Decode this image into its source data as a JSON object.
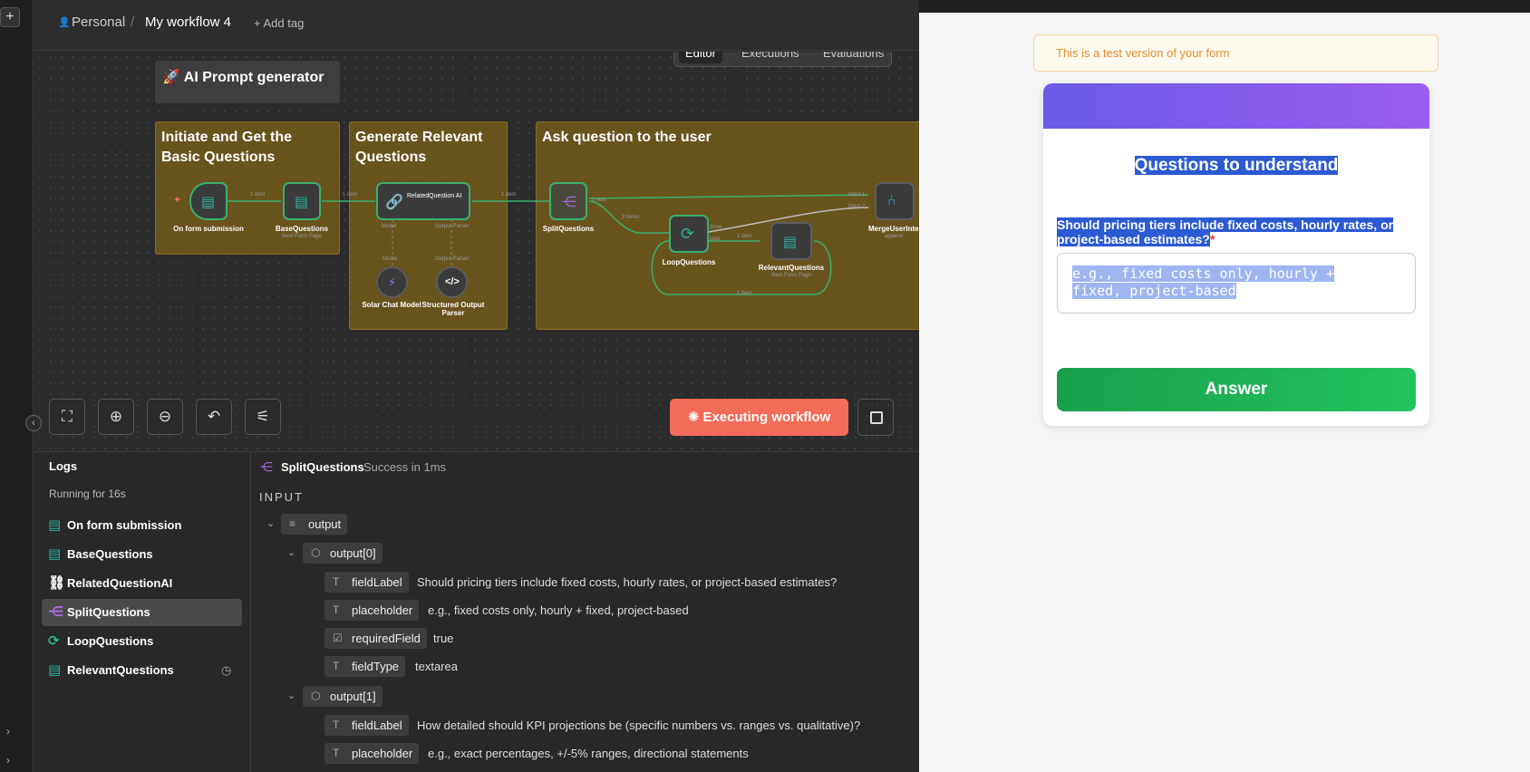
{
  "topbar": {
    "project": "Personal",
    "sep": "/",
    "workflow_name": "My workflow 4",
    "add_tag": "+ Add tag"
  },
  "tabs": [
    "Editor",
    "Executions",
    "Evaluations"
  ],
  "canvas": {
    "title_card": "🚀 AI Prompt generator",
    "groups": [
      "Initiate and Get the Basic Questions",
      "Generate Relevant Questions",
      "Ask question to the user"
    ],
    "nodes": {
      "form_submission": {
        "label": "On form submission"
      },
      "base_questions": {
        "label": "BaseQuestions",
        "sub": "Next Form Page"
      },
      "related_ai": {
        "label": "RelatedQuestion AI"
      },
      "split": {
        "label": "SplitQuestions"
      },
      "loop": {
        "label": "LoopQuestions"
      },
      "relevant": {
        "label": "RelevantQuestions",
        "sub": "Next Form Page"
      },
      "merge": {
        "label": "MergeUserInter",
        "sub": "append"
      },
      "solar": {
        "label": "Solar Chat Model"
      },
      "parser": {
        "label": "Structured Output Parser"
      }
    },
    "edge_labels": {
      "item1": "1 item",
      "items3": "3 items",
      "done": "done",
      "loop": "loop",
      "model": "Model",
      "output_parser": "Output Parser",
      "input1": "Input 1",
      "input2": "Input 2"
    }
  },
  "controls": {
    "execute_label": "Executing workflow"
  },
  "logs": {
    "title": "Logs",
    "status": "Running for 16s",
    "items": [
      {
        "label": "On form submission",
        "icon": "form-icon",
        "color": "#2ab3a0"
      },
      {
        "label": "BaseQuestions",
        "icon": "form-icon",
        "color": "#2ab3a0"
      },
      {
        "label": "RelatedQuestionAI",
        "icon": "link-icon",
        "color": "#ffffff"
      },
      {
        "label": "SplitQuestions",
        "icon": "split-icon",
        "color": "#a66be0"
      },
      {
        "label": "LoopQuestions",
        "icon": "loop-icon",
        "color": "#2ab38f"
      },
      {
        "label": "RelevantQuestions",
        "icon": "form-icon",
        "color": "#2ab3a0"
      }
    ]
  },
  "detail": {
    "node": "SplitQuestions",
    "status": "Success in 1ms",
    "section": "INPUT",
    "root": "output",
    "items": [
      {
        "name": "output[0]",
        "fields": [
          {
            "key": "fieldLabel",
            "value": "Should pricing tiers include fixed costs, hourly rates, or project-based estimates?"
          },
          {
            "key": "placeholder",
            "value": "e.g., fixed costs only, hourly + fixed, project-based"
          },
          {
            "key": "requiredField",
            "value": "true"
          },
          {
            "key": "fieldType",
            "value": "textarea"
          }
        ]
      },
      {
        "name": "output[1]",
        "fields": [
          {
            "key": "fieldLabel",
            "value": "How detailed should KPI projections be (specific numbers vs. ranges vs. qualitative)?"
          },
          {
            "key": "placeholder",
            "value": "e.g., exact percentages, +/-5% ranges, directional statements"
          }
        ]
      }
    ]
  },
  "form": {
    "test_note": "This is a test version of your form",
    "title": "Questions to understand",
    "question": "Should pricing tiers include fixed costs, hourly rates, or project-based estimates?",
    "required_mark": "*",
    "placeholder_line1": "e.g., fixed costs only, hourly +",
    "placeholder_line2": "fixed, project-based",
    "submit_label": "Answer"
  },
  "colors": {
    "accent_exec": "#f36b59",
    "success": "#22c35e",
    "sticky": "#7a5f19"
  }
}
